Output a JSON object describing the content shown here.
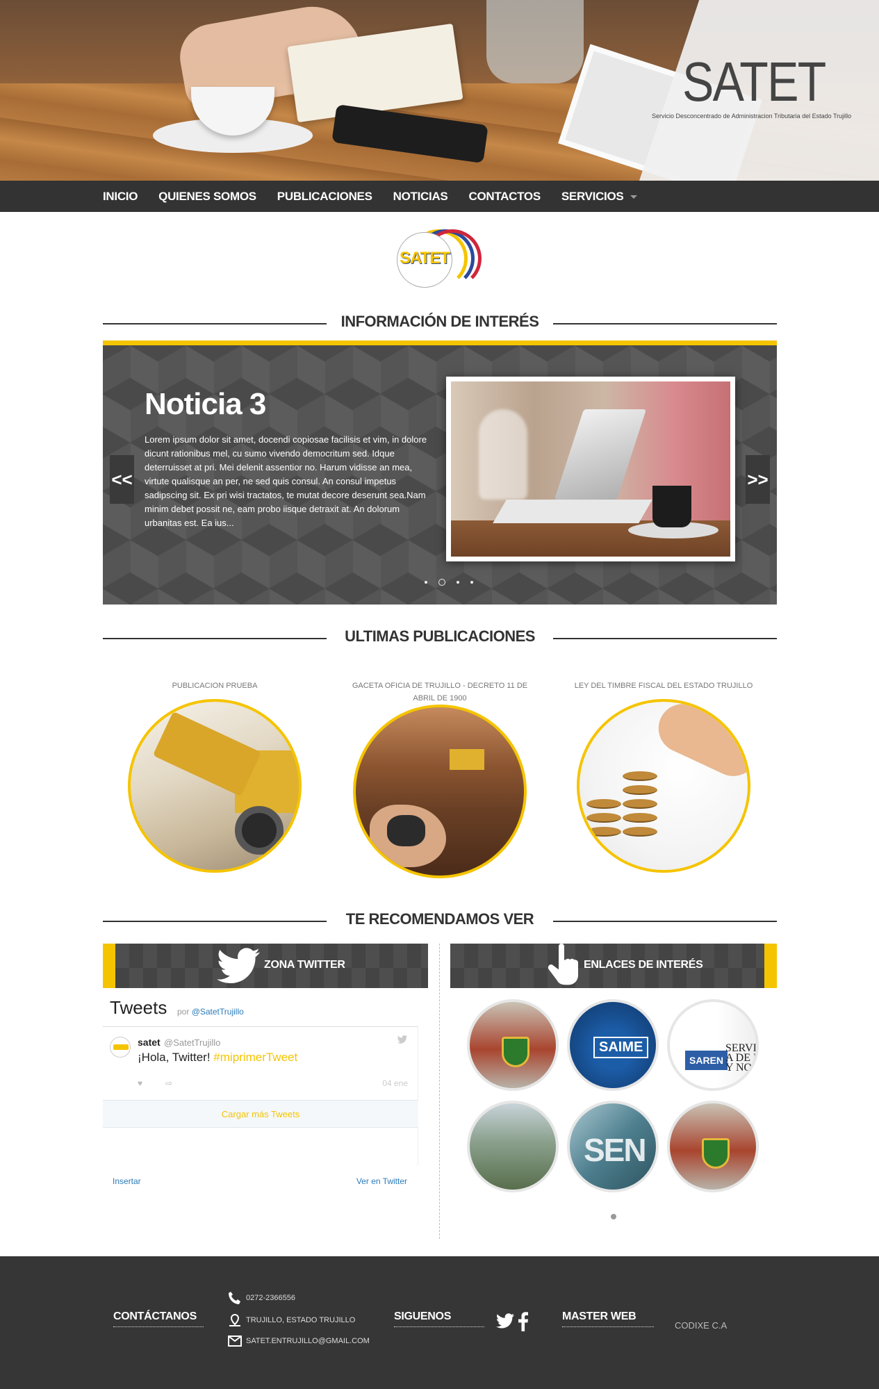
{
  "header": {
    "brand": "SATET",
    "brand_sub": "Servicio Desconcentrado de Administracion Tributaria del Estado Trujillo",
    "stripe_colors": [
      "#f5c400",
      "#2b4a9c",
      "#d0263c"
    ]
  },
  "nav": {
    "items": [
      "INICIO",
      "QUIENES SOMOS",
      "PUBLICACIONES",
      "NOTICIAS",
      "CONTACTOS",
      "SERVICIOS"
    ]
  },
  "logo_text": "SATET",
  "sections": {
    "info": "INFORMACIÓN DE INTERÉS",
    "pubs": "ULTIMAS PUBLICACIONES",
    "recomendamos": "TE RECOMENDAMOS VER"
  },
  "slider": {
    "title": "Noticia 3",
    "body": "Lorem ipsum dolor sit amet, docendi copiosae facilisis et vim, in dolore dicunt rationibus mel, cu sumo vivendo democritum sed. Idque deterruisset at pri. Mei delenit assentior no. Harum vidisse an mea, virtute qualisque an per, ne sed quis consul. An consul impetus sadipscing sit. Ex pri wisi tractatos, te mutat decore deserunt sea.Nam minim debet possit ne, eam probo iisque detraxit at. An dolorum urbanitas est. Ea ius...",
    "prev": "<<",
    "next": ">>",
    "dots": 4,
    "active_dot": 2
  },
  "publications": [
    {
      "caption": "PUBLICACION PRUEBA"
    },
    {
      "caption": "GACETA OFICIA DE TRUJILLO - DECRETO 11 DE ABRIL DE 1900"
    },
    {
      "caption": "LEY DEL TIMBRE FISCAL DEL ESTADO TRUJILLO"
    }
  ],
  "twitter": {
    "panel": "ZONA TWITTER",
    "title": "Tweets",
    "by": "por",
    "by_handle": "@SatetTrujillo",
    "tweet": {
      "name": "satet",
      "handle": "@SatetTrujillo",
      "text": "¡Hola, Twitter!",
      "hashtag": "#miprimerTweet",
      "date": "04 ene"
    },
    "load_more": "Cargar más Tweets",
    "embed": "Insertar",
    "view": "Ver en Twitter"
  },
  "links": {
    "panel": "ENLACES DE INTERÉS",
    "items": [
      {
        "label": ""
      },
      {
        "label": "SAIME"
      },
      {
        "label": "SAREN",
        "extra": "SERVICIO A DE REG Y NO"
      },
      {
        "label": ""
      },
      {
        "label": "SEN"
      },
      {
        "label": ""
      }
    ]
  },
  "footer": {
    "contact_title": "CONTÁCTANOS",
    "phone": "0272-2366556",
    "address": "TRUJILLO, ESTADO TRUJILLO",
    "email": "SATET.ENTRUJILLO@GMAIL.COM",
    "follow_title": "SIGUENOS",
    "master_title": "MASTER WEB",
    "master_value": "CODIXE C.A"
  }
}
